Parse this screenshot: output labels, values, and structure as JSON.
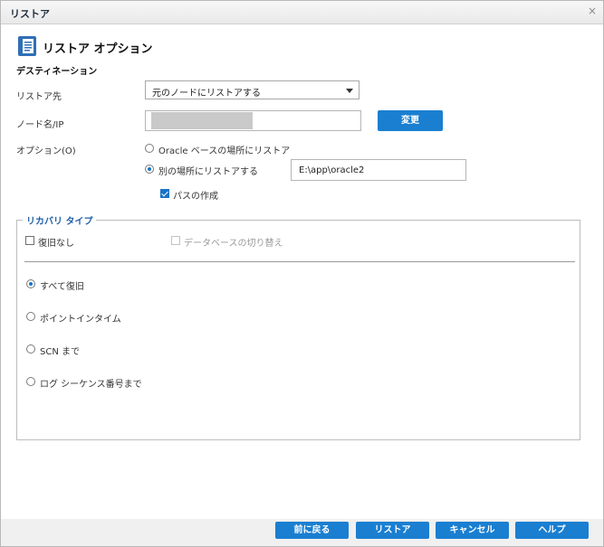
{
  "window": {
    "title": "リストア",
    "close_glyph": "×"
  },
  "header": {
    "title": "リストア オプション",
    "icon": "document-icon"
  },
  "destination": {
    "section_label": "デスティネーション",
    "restore_to_label": "リストア先",
    "restore_to_value": "元のノードにリストアする",
    "node_label": "ノード名/IP",
    "change_button": "変更",
    "options_label": "オプション(O)",
    "option_oracle_base": "Oracle ベースの場所にリストア",
    "option_other_location": "別の場所にリストアする",
    "path_value": "E:\\app\\oracle2",
    "create_path_label": "パスの作成"
  },
  "recovery": {
    "legend": "リカバリ タイプ",
    "no_recovery_label": "復旧なし",
    "switch_db_label": "データベースの切り替え",
    "options": [
      "すべて復旧",
      "ポイントインタイム",
      "SCN まで",
      "ログ シーケンス番号まで"
    ]
  },
  "footer": {
    "back": "前に戻る",
    "restore": "リストア",
    "cancel": "キャンセル",
    "help": "ヘルプ"
  },
  "colors": {
    "accent": "#1a7fd1",
    "legend": "#1f5fa8"
  }
}
